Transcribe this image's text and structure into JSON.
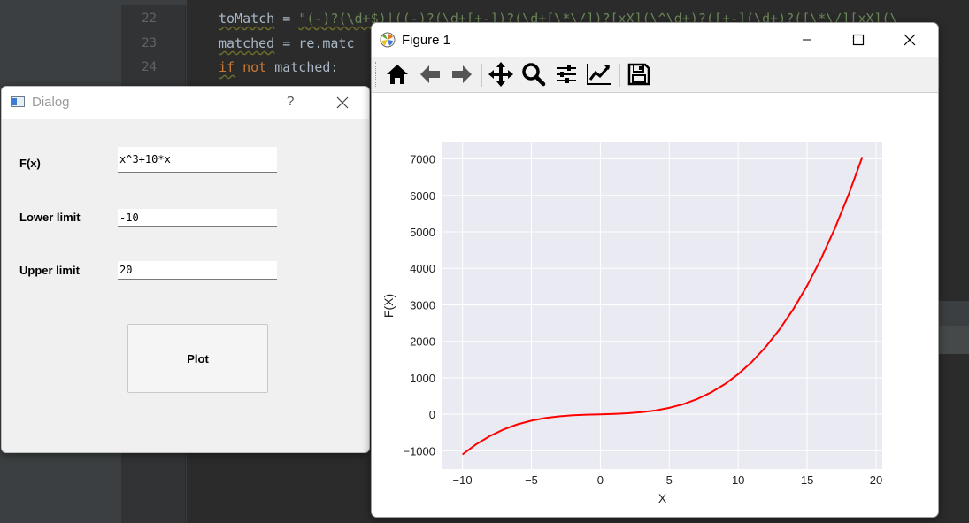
{
  "editor": {
    "line_numbers": [
      "22",
      "23",
      "24"
    ],
    "lines": [
      {
        "var": "toMatch",
        "op": " = ",
        "str": "\"(-)?(\\d+$)|((-)?(\\d+[+-])?(\\d+[\\*\\/])?[xX](\\^\\d+)?([+-](\\d+)?([\\*\\/][xX](\\"
      },
      {
        "var": "matched",
        "op": " = re.matc",
        "str": ""
      },
      {
        "kw1": "if",
        "kw2": "not",
        "rest": "matched:"
      }
    ]
  },
  "dialog": {
    "title": "Dialog",
    "help_label": "?",
    "fx_label": "F(x)",
    "fx_value": "x^3+10*x",
    "lower_label": "Lower limit",
    "lower_value": "-10",
    "upper_label": "Upper limit",
    "upper_value": "20",
    "plot_label": "Plot"
  },
  "figure": {
    "title": "Figure 1",
    "toolbar_icons": [
      "home-icon",
      "back-arrow-icon",
      "forward-arrow-icon",
      "pan-icon",
      "zoom-icon",
      "subplots-icon",
      "edit-axis-icon",
      "save-icon"
    ]
  },
  "chart_data": {
    "type": "line",
    "title": "",
    "xlabel": "X",
    "ylabel": "F(X)",
    "xlim": [
      -11.45,
      20.45
    ],
    "ylim": [
      -1500,
      7450
    ],
    "xticks": [
      -10,
      -5,
      0,
      5,
      10,
      15,
      20
    ],
    "yticks": [
      -1000,
      0,
      1000,
      2000,
      3000,
      4000,
      5000,
      6000,
      7000
    ],
    "grid": true,
    "background": "#eaeaf2",
    "series": [
      {
        "color": "#ff0000",
        "x": [
          -10,
          -9,
          -8,
          -7,
          -6,
          -5,
          -4,
          -3,
          -2,
          -1,
          0,
          1,
          2,
          3,
          4,
          5,
          6,
          7,
          8,
          9,
          10,
          11,
          12,
          13,
          14,
          15,
          16,
          17,
          18,
          19
        ],
        "y": [
          -1100,
          -819,
          -592,
          -413,
          -276,
          -175,
          -104,
          -57,
          -28,
          -11,
          0,
          11,
          28,
          57,
          104,
          175,
          276,
          413,
          592,
          819,
          1100,
          1441,
          1848,
          2327,
          2884,
          3525,
          4256,
          5083,
          6012,
          7049
        ]
      }
    ]
  }
}
